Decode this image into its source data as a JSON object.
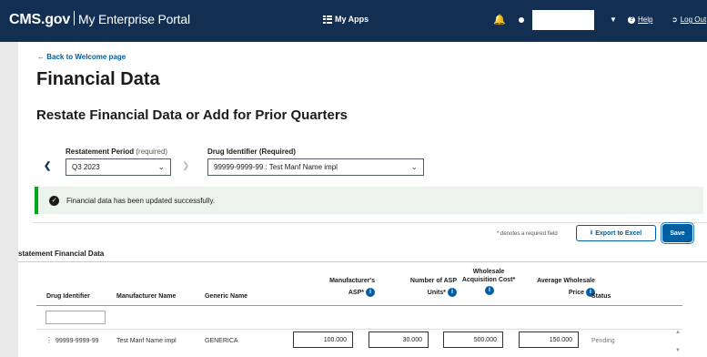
{
  "header": {
    "brand": "CMS.gov",
    "portal": "My Enterprise Portal",
    "my_apps": "My Apps",
    "help": "Help",
    "logout": "Log Out"
  },
  "page": {
    "back_link": "← Back to Welcome page",
    "title": "Financial Data",
    "subtitle": "Restate Financial Data or Add for Prior Quarters"
  },
  "filters": {
    "period_label": "Restatement Period",
    "period_req": "(required)",
    "period_value": "Q3 2023",
    "drug_label": "Drug Identifier (Required)",
    "drug_value": "99999-9999-99 : Test Manf Name impl"
  },
  "alert": {
    "message": "Financial data has been updated successfully."
  },
  "toolbar": {
    "required_note": "* denotes a required field",
    "export_label": "Export to Excel",
    "save_label": "Save"
  },
  "table": {
    "section_title": "statement Financial Data",
    "headers": {
      "drug_identifier": "Drug Identifier",
      "manufacturer_name": "Manufacturer Name",
      "generic_name": "Generic Name",
      "asp_line1": "Manufacturer's",
      "asp_line2": "ASP*",
      "units_line1": "Number of ASP",
      "units_line2": "Units*",
      "wac_line1": "Wholesale",
      "wac_line2": "Acquisition Cost*",
      "awp_line1": "Average Wholesale",
      "awp_line2": "Price",
      "status": "Status"
    },
    "rows": [
      {
        "drug_identifier": "99999-9999-99",
        "manufacturer_name": "Test Manf Name impl",
        "generic_name": "GENERICA",
        "asp": "100.000",
        "units": "30.000",
        "wac": "500.000",
        "awp": "150.000",
        "status": "Pending"
      }
    ]
  },
  "colors": {
    "nav": "#122e51",
    "link": "#005ea2",
    "success": "#00a91c"
  }
}
